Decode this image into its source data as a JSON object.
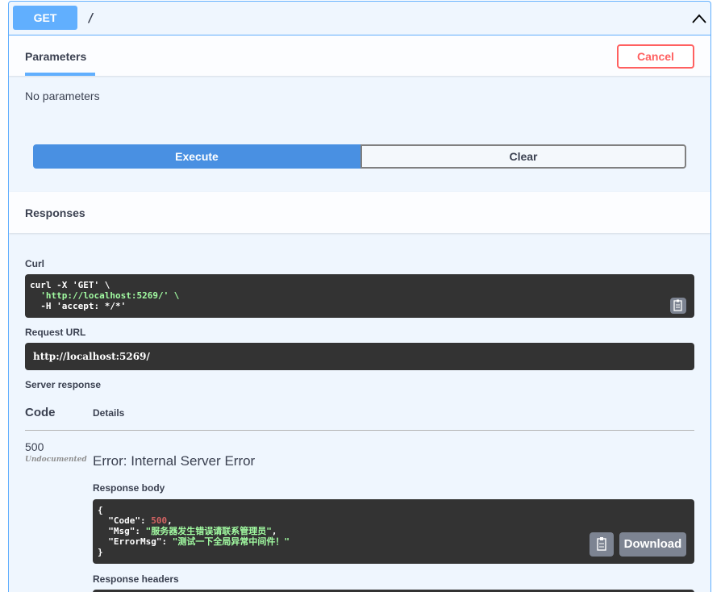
{
  "summary": {
    "method": "GET",
    "path": "/"
  },
  "parameters": {
    "tab_label": "Parameters",
    "cancel_label": "Cancel",
    "empty_text": "No parameters"
  },
  "actions": {
    "execute_label": "Execute",
    "clear_label": "Clear"
  },
  "responses": {
    "title": "Responses",
    "curl_label": "Curl",
    "curl_lines": [
      "curl -X 'GET' \\",
      "  'http://localhost:5269/' \\",
      "  -H 'accept: */*'"
    ],
    "request_url_label": "Request URL",
    "request_url": "http://localhost:5269/",
    "server_response_label": "Server response",
    "col_code": "Code",
    "col_details": "Details",
    "code": "500",
    "undocumented": "Undocumented",
    "error_title": "Error: Internal Server Error",
    "response_body_label": "Response body",
    "body_lines": [
      {
        "pre": "{",
        "val": "",
        "post": ""
      },
      {
        "pre": "  \"Code\": ",
        "val": "500",
        "post": ",",
        "kind": "num"
      },
      {
        "pre": "  \"Msg\": ",
        "val": "\"服务器发生错误请联系管理员\"",
        "post": ",",
        "kind": "str"
      },
      {
        "pre": "  \"ErrorMsg\": ",
        "val": "\"测试一下全局异常中间件！\"",
        "post": "",
        "kind": "str"
      },
      {
        "pre": "}",
        "val": "",
        "post": ""
      }
    ],
    "download_label": "Download",
    "response_headers_label": "Response headers"
  },
  "icons": [
    "chevron-up-icon",
    "copy-icon"
  ],
  "colors": {
    "get": "#61affe",
    "execute": "#4990e2",
    "cancel": "#ff6060",
    "code_bg": "#333333"
  }
}
